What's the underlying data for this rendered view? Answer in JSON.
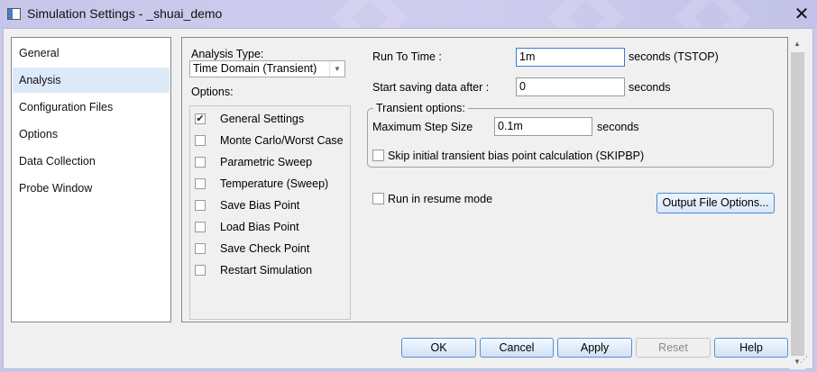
{
  "window": {
    "title": "Simulation Settings - _shuai_demo",
    "close_glyph": "✕"
  },
  "sidebar": {
    "items": [
      {
        "label": "General",
        "selected": false
      },
      {
        "label": "Analysis",
        "selected": true
      },
      {
        "label": "Configuration Files",
        "selected": false
      },
      {
        "label": "Options",
        "selected": false
      },
      {
        "label": "Data Collection",
        "selected": false
      },
      {
        "label": "Probe Window",
        "selected": false
      }
    ]
  },
  "analysis": {
    "type_label": "Analysis Type:",
    "type_value": "Time Domain (Transient)",
    "options_label": "Options:",
    "options": [
      {
        "label": "General Settings",
        "checked": true
      },
      {
        "label": "Monte Carlo/Worst Case",
        "checked": false
      },
      {
        "label": "Parametric Sweep",
        "checked": false
      },
      {
        "label": "Temperature (Sweep)",
        "checked": false
      },
      {
        "label": "Save Bias Point",
        "checked": false
      },
      {
        "label": "Load Bias Point",
        "checked": false
      },
      {
        "label": "Save Check Point",
        "checked": false
      },
      {
        "label": "Restart Simulation",
        "checked": false
      }
    ]
  },
  "settings": {
    "run_to_time_label": "Run To Time :",
    "run_to_time_value": "1m",
    "run_to_time_unit": "seconds (TSTOP)",
    "start_saving_label": "Start saving data after :",
    "start_saving_value": "0",
    "start_saving_unit": "seconds",
    "transient_group_label": "Transient options:",
    "max_step_label": "Maximum Step Size",
    "max_step_value": "0.1m",
    "max_step_unit": "seconds",
    "skip_bias_label": "Skip initial transient bias point calculation (SKIPBP)",
    "skip_bias_checked": false,
    "resume_label": "Run in resume mode",
    "resume_checked": false,
    "output_file_options_label": "Output File Options..."
  },
  "buttons": {
    "ok": "OK",
    "cancel": "Cancel",
    "apply": "Apply",
    "reset": "Reset",
    "help": "Help"
  },
  "colors": {
    "titlebar": "#c9c8e8",
    "selection": "#dde9f8",
    "accent_border": "#4a8ad8"
  }
}
